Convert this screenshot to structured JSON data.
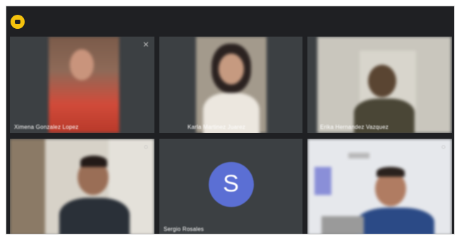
{
  "meeting": {
    "app_badge_icon": "meeting-app-icon",
    "tiles": [
      {
        "name": "Ximena Gonzalez Lopez",
        "icon": "more-options-icon"
      },
      {
        "name": "Karla Martinez Juarez",
        "icon": ""
      },
      {
        "name": "Erika Hernandez Vazquez",
        "icon": ""
      },
      {
        "name": "",
        "icon": "pin-icon"
      },
      {
        "name": "Sergio Rosales",
        "avatar_initial": "S",
        "avatar_color": "#5b6fd4"
      },
      {
        "name": "",
        "icon": "pin-icon"
      }
    ]
  }
}
